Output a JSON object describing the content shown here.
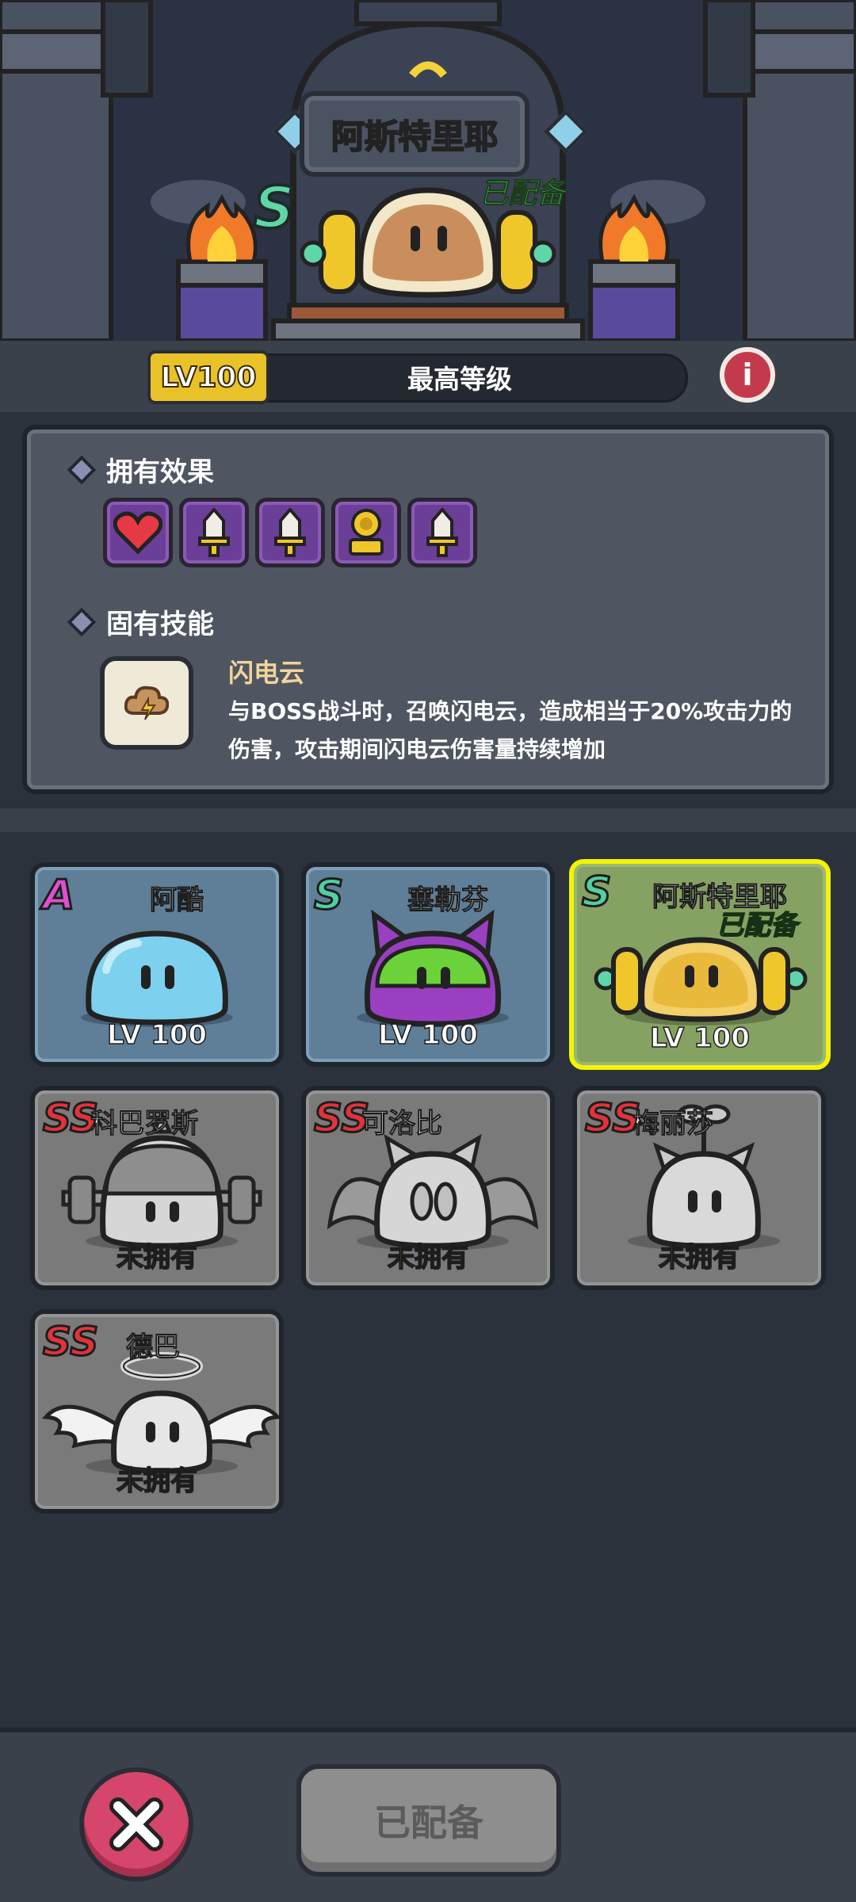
{
  "hero": {
    "name": "阿斯特里耶",
    "grade": "S",
    "equipped_label": "已配备",
    "level_badge": "LV100",
    "level_status": "最高等级",
    "info_icon": "info-icon"
  },
  "panel": {
    "effects_title": "拥有效果",
    "effect_icons": [
      "heart-icon",
      "sword-icon",
      "sword-icon",
      "coin-icon",
      "sword-icon"
    ],
    "skill_title": "固有技能",
    "skill_icon": "lightning-cloud-icon",
    "skill_name": "闪电云",
    "skill_desc": "与BOSS战斗时，召唤闪电云，造成相当于20%攻击力的伤害，攻击期间闪电云伤害量持续增加"
  },
  "pets": [
    {
      "grade": "A",
      "name": "阿酷",
      "level": "LV 100",
      "state": "owned"
    },
    {
      "grade": "S",
      "name": "塞勒芬",
      "level": "LV 100",
      "state": "owned"
    },
    {
      "grade": "S",
      "name": "阿斯特里耶",
      "level": "LV 100",
      "state": "selected",
      "equipped": "已配备"
    },
    {
      "grade": "SS",
      "name": "科巴罗斯",
      "status": "未拥有",
      "state": "locked"
    },
    {
      "grade": "SS",
      "name": "可洛比",
      "status": "未拥有",
      "state": "locked"
    },
    {
      "grade": "SS",
      "name": "梅丽莎",
      "status": "未拥有",
      "state": "locked"
    },
    {
      "grade": "SS",
      "name": "德巴",
      "status": "未拥有",
      "state": "locked"
    }
  ],
  "bottom": {
    "close_icon": "close-icon",
    "equip_button": "已配备"
  },
  "colors": {
    "grade_A": "#e04fd0",
    "grade_S": "#4fd0a2",
    "grade_SS": "#e4323a",
    "equipped_green": "#43e04a",
    "selected_border": "#f4f300",
    "not_owned_yellow": "#ffd43a"
  }
}
